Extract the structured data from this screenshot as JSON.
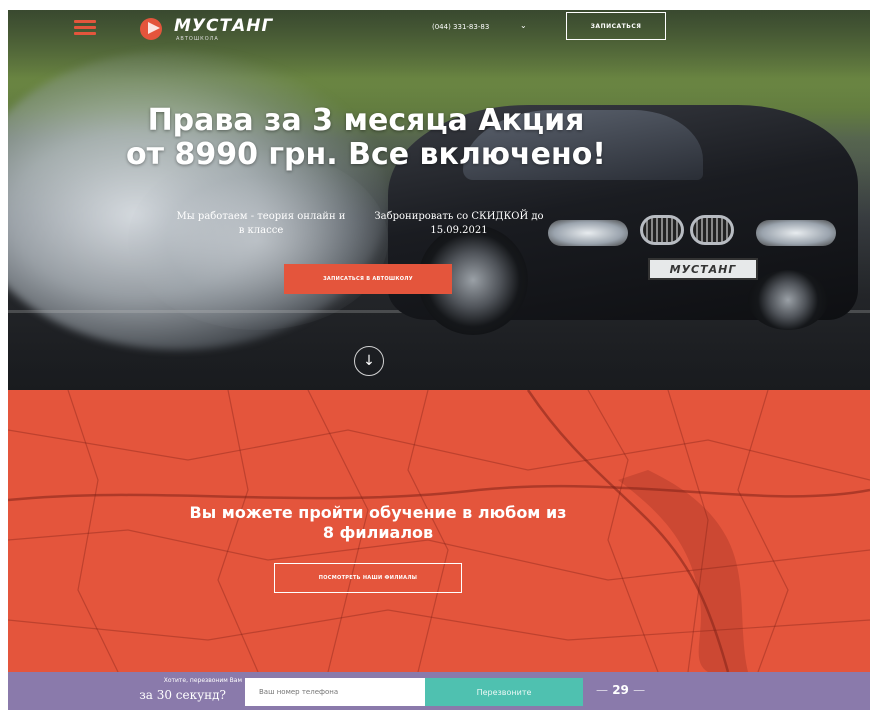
{
  "brand": {
    "name": "МУСТАНГ",
    "tagline": "АВТОШКОЛА",
    "accent": "#e4553c",
    "purple": "#8a7aab",
    "teal": "#4fc1b0"
  },
  "nav": {
    "menu_icon": "hamburger-icon",
    "phone": "(044) 331-83-83",
    "phone_chevron": "⌄",
    "signup_label": "ЗАПИСАТЬСЯ"
  },
  "hero": {
    "title": "Права за 3 месяца Акция от 8990 грн. Все включено!",
    "col1": "Мы работаем - теория онлайн и в классе",
    "col2": "Забронировать со СКИДКОЙ до 15.09.2021",
    "cta_label": "ЗАПИСАТЬСЯ В АВТОШКОЛУ",
    "plate": "МУСТАНГ",
    "scroll_icon": "arrow-down-icon",
    "scroll_glyph": "↓"
  },
  "map_section": {
    "title": "Вы можете пройти обучение в любом из 8 филиалов",
    "cta_label": "ПОСМОТРЕТЬ НАШИ ФИЛИАЛЫ"
  },
  "callback": {
    "line1": "Хотите, перезвоним Вам",
    "line2": "за 30 секунд?",
    "input_placeholder": "Ваш номер телефона",
    "button_label": "Перезвоните",
    "timer_value": "29",
    "timer_dash": "—"
  }
}
